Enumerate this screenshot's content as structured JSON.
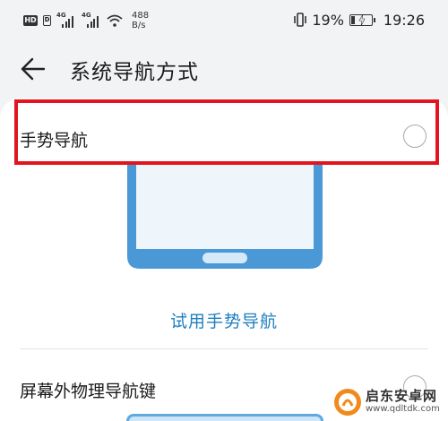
{
  "status_bar": {
    "hd_label": "HD",
    "hd_sub": "D",
    "sim1_gen": "4G",
    "sim2_gen": "4G",
    "net_speed_value": "488",
    "net_speed_unit": "B/s",
    "battery_percent": "19%",
    "battery_level": 0.19,
    "charging": true,
    "time": "19:26"
  },
  "header": {
    "title": "系统导航方式",
    "back_icon": "arrow-left-icon"
  },
  "options": [
    {
      "label": "手势导航",
      "selected": false
    },
    {
      "label": "屏幕外物理导航键",
      "selected": false
    }
  ],
  "try_link": "试用手势导航",
  "colors": {
    "accent": "#1e7fc0",
    "highlight": "#e3141f",
    "phone_frame": "#4a98d6",
    "phone_screen": "#eef5fb"
  },
  "watermark": {
    "name": "启东安卓网",
    "url": "www.qdltdk.com"
  }
}
